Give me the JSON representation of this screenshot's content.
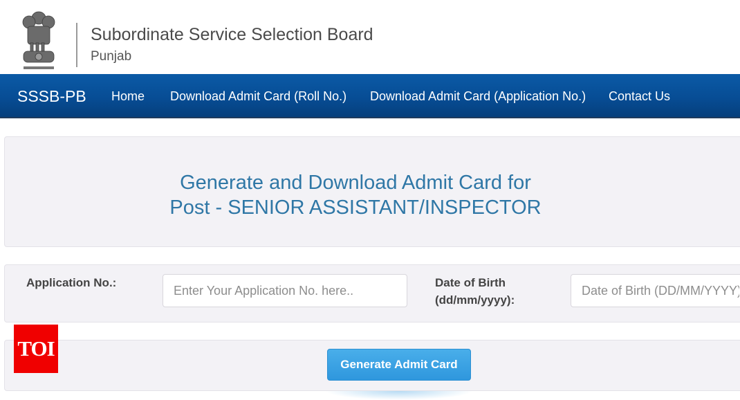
{
  "header": {
    "emblem_icon": "national-emblem-icon",
    "title": "Subordinate Service Selection Board",
    "subtitle": "Punjab"
  },
  "navbar": {
    "brand": "SSSB-PB",
    "items": [
      {
        "label": "Home"
      },
      {
        "label": "Download Admit Card (Roll No.)"
      },
      {
        "label": "Download Admit Card (Application No.)"
      },
      {
        "label": "Contact Us"
      }
    ]
  },
  "main": {
    "title_line1": "Generate and Download Admit Card for",
    "title_line2": "Post - SENIOR ASSISTANT/INSPECTOR",
    "form": {
      "application_label": "Application No.:",
      "application_placeholder": "Enter Your Application No. here..",
      "application_value": "",
      "dob_label_line1": "Date of Birth",
      "dob_label_line2": "(dd/mm/yyyy):",
      "dob_placeholder": "Date of Birth (DD/MM/YYYY)",
      "dob_value": ""
    },
    "generate_button": "Generate Admit Card"
  },
  "watermark": {
    "text": "TOI",
    "color": "#f00000"
  },
  "colors": {
    "nav_blue": "#074d95",
    "title_blue": "#2f77a6",
    "button_blue": "#3a9fe2",
    "panel_bg": "#f3f2f6"
  }
}
